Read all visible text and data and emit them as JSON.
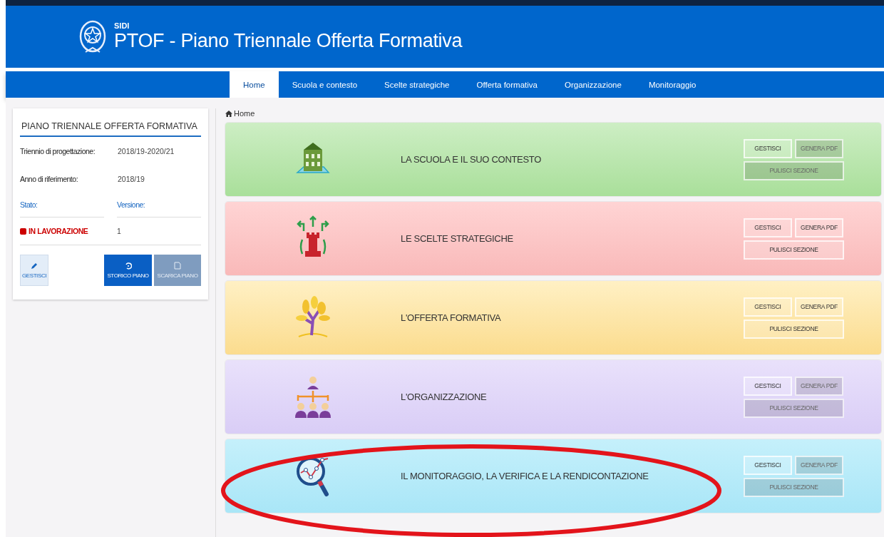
{
  "header": {
    "label": "SIDI",
    "title": "PTOF - Piano Triennale Offerta Formativa"
  },
  "nav": [
    {
      "label": "Home",
      "selected": true
    },
    {
      "label": "Scuola e contesto",
      "selected": false
    },
    {
      "label": "Scelte strategiche",
      "selected": false
    },
    {
      "label": "Offerta formativa",
      "selected": false
    },
    {
      "label": "Organizzazione",
      "selected": false
    },
    {
      "label": "Monitoraggio",
      "selected": false
    }
  ],
  "sidebar": {
    "title": "PIANO TRIENNALE OFFERTA FORMATIVA",
    "fields": [
      {
        "label": "Triennio di progettazione:",
        "value": "2018/19-2020/21"
      },
      {
        "label": "Anno di riferimento:",
        "value": "2018/19"
      }
    ],
    "stato_label": "Stato:",
    "versione_label": "Versione:",
    "stato": {
      "label": "IN LAVORAZIONE",
      "color": "#cc0000"
    },
    "versione": "1",
    "buttons": [
      {
        "label": "GESTISCI",
        "kind": "edit",
        "disabled": false
      },
      {
        "label": "STORICO PIANO",
        "kind": "history",
        "disabled": false
      },
      {
        "label": "SCARICA PIANO",
        "kind": "download",
        "disabled": true
      }
    ]
  },
  "breadcrumb": "Home",
  "sections": [
    {
      "kind": "school",
      "title": "LA SCUOLA E IL SUO CONTESTO",
      "buttons": [
        {
          "label": "GESTISCI",
          "disabled": false
        },
        {
          "label": "GENERA PDF",
          "disabled": true
        },
        {
          "label": "PULISCI SEZIONE",
          "disabled": true
        }
      ]
    },
    {
      "kind": "strategy",
      "title": "LE SCELTE STRATEGICHE",
      "buttons": [
        {
          "label": "GESTISCI",
          "disabled": false
        },
        {
          "label": "GENERA PDF",
          "disabled": false
        },
        {
          "label": "PULISCI SEZIONE",
          "disabled": false
        }
      ]
    },
    {
      "kind": "offer",
      "title": "L'OFFERTA FORMATIVA",
      "buttons": [
        {
          "label": "GESTISCI",
          "disabled": false
        },
        {
          "label": "GENERA PDF",
          "disabled": false
        },
        {
          "label": "PULISCI SEZIONE",
          "disabled": false
        }
      ]
    },
    {
      "kind": "organization",
      "title": "L'ORGANIZZAZIONE",
      "buttons": [
        {
          "label": "GESTISCI",
          "disabled": false
        },
        {
          "label": "GENERA PDF",
          "disabled": true
        },
        {
          "label": "PULISCI SEZIONE",
          "disabled": true
        }
      ]
    },
    {
      "kind": "monitoring",
      "title": "IL MONITORAGGIO, LA VERIFICA E LA RENDICONTAZIONE",
      "buttons": [
        {
          "label": "GESTISCI",
          "disabled": false
        },
        {
          "label": "GENERA PDF",
          "disabled": true
        },
        {
          "label": "PULISCI SEZIONE",
          "disabled": true
        }
      ]
    }
  ]
}
